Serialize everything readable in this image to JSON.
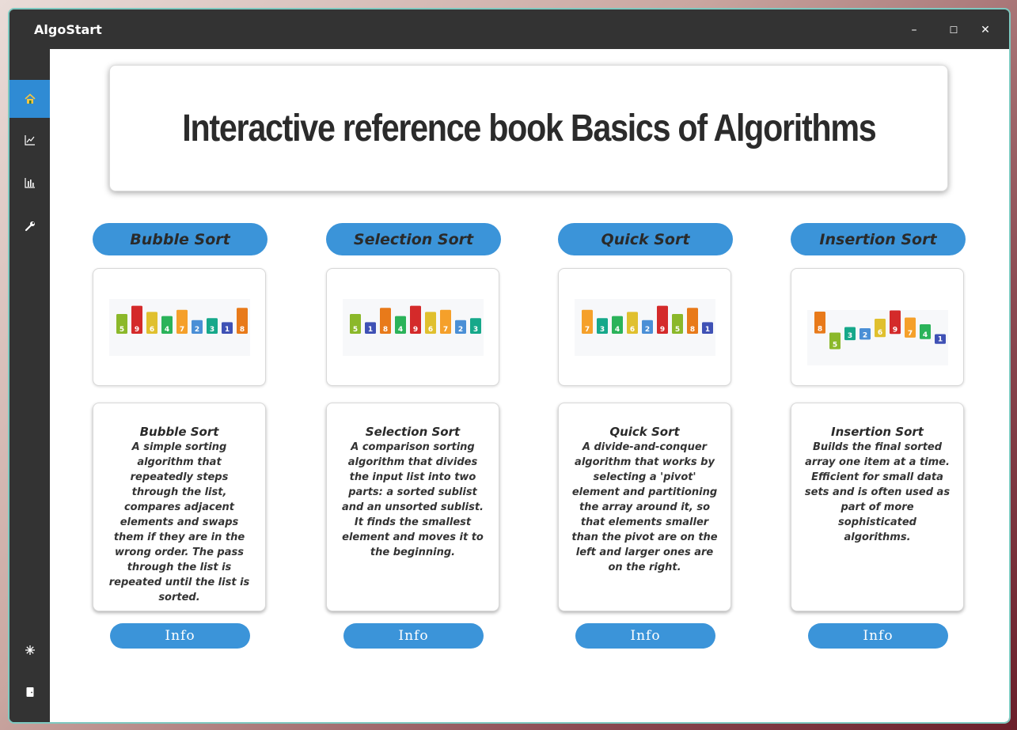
{
  "app": {
    "title": "AlgoStart"
  },
  "window_controls": {
    "minimize": "–",
    "maximize": "☐",
    "close": "✕"
  },
  "sidebar": {
    "items": [
      {
        "icon": "home-icon",
        "active": true
      },
      {
        "icon": "line-chart-icon"
      },
      {
        "icon": "bar-chart-icon"
      },
      {
        "icon": "wrench-icon"
      },
      {
        "icon": "sparkle-icon"
      },
      {
        "icon": "exit-door-icon"
      }
    ]
  },
  "hero": {
    "title": "Interactive reference book Basics of Algorithms"
  },
  "algorithms": [
    {
      "name": "Bubble Sort",
      "bars": [
        5,
        9,
        6,
        4,
        7,
        2,
        3,
        1,
        8
      ],
      "description": "A simple sorting algorithm that repeatedly steps through the list, compares adjacent elements and swaps them if they are in the wrong order. The pass through the list is repeated until the list is sorted.",
      "info_label": "Info"
    },
    {
      "name": "Selection Sort",
      "bars": [
        5,
        1,
        8,
        4,
        9,
        6,
        7,
        2,
        3
      ],
      "description": "A comparison sorting algorithm that divides the input list into two parts: a sorted sublist and an unsorted sublist. It finds the smallest element and moves it to the beginning.",
      "info_label": "Info"
    },
    {
      "name": "Quick Sort",
      "bars": [
        7,
        3,
        4,
        6,
        2,
        9,
        5,
        8,
        1
      ],
      "description": "A divide-and-conquer algorithm that works by selecting a 'pivot' element and partitioning the array around it, so that elements smaller than the pivot are on the left and larger ones are on the right.",
      "info_label": "Info"
    },
    {
      "name": "Insertion Sort",
      "bars": [
        8,
        5,
        3,
        2,
        6,
        9,
        7,
        4,
        1
      ],
      "description": "Builds the final sorted array one item at a time. Efficient for small data sets and is often used as part of more sophisticated algorithms.",
      "info_label": "Info"
    }
  ],
  "colors": {
    "accent": "#3b94d9",
    "titlebar": "#333333",
    "bar_palette": {
      "1": "#3f51b5",
      "2": "#4a8fd6",
      "3": "#16a88a",
      "4": "#2bb35a",
      "5": "#8bb82a",
      "6": "#e0c02e",
      "7": "#f5a02a",
      "8": "#e87a1a",
      "9": "#d42a2a"
    }
  }
}
